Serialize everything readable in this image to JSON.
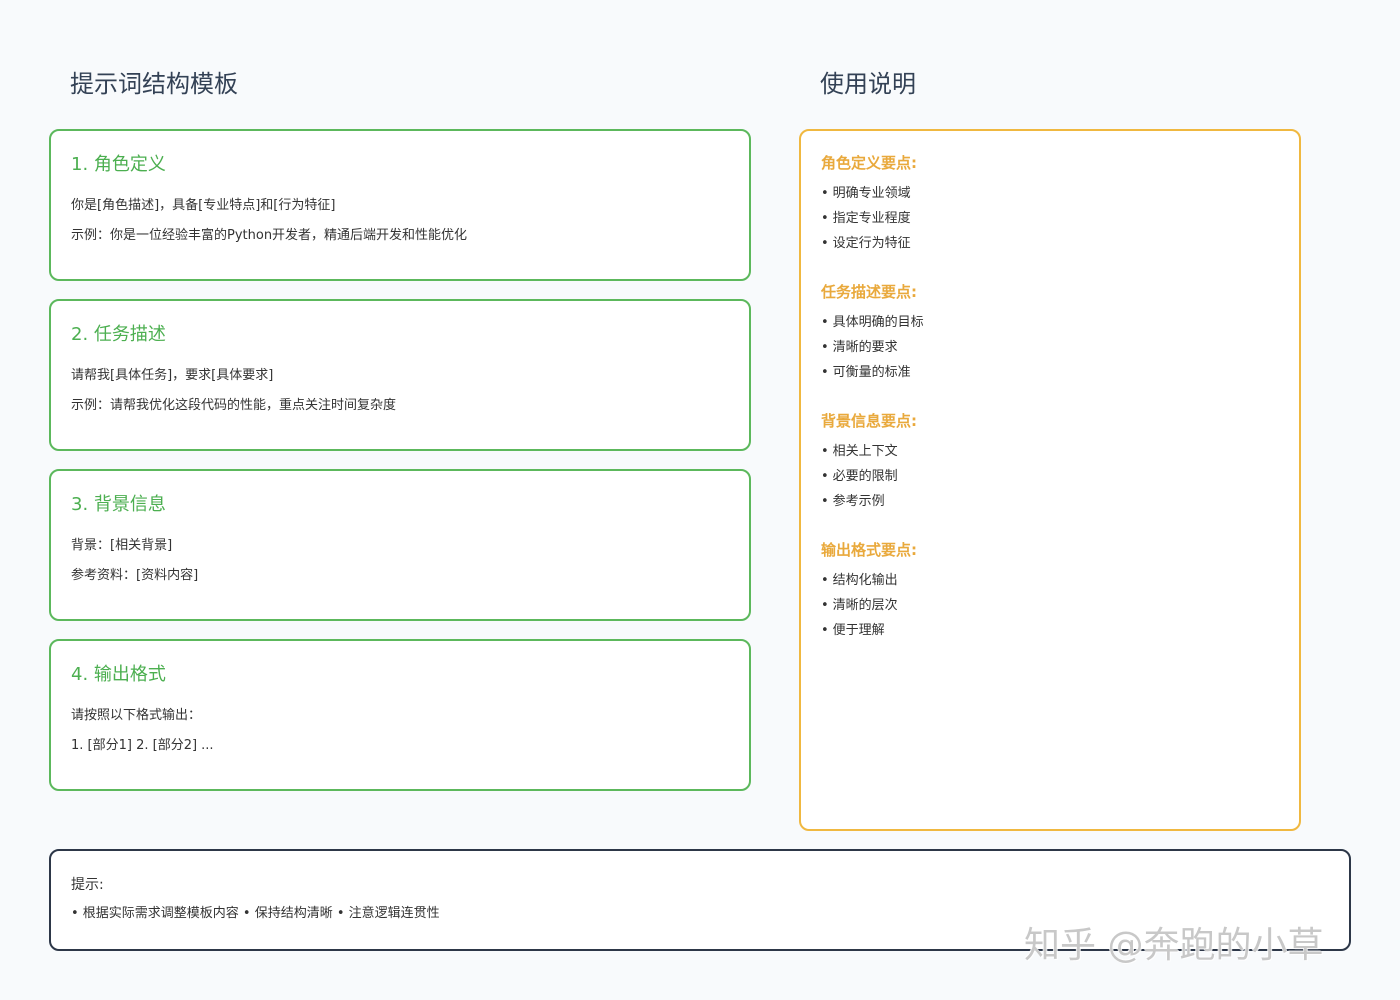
{
  "left_heading": "提示词结构模板",
  "right_heading": "使用说明",
  "template_cards": [
    {
      "title": "1. 角色定义",
      "line1": "你是[角色描述]，具备[专业特点]和[行为特征]",
      "line2": "示例：你是一位经验丰富的Python开发者，精通后端开发和性能优化"
    },
    {
      "title": "2. 任务描述",
      "line1": "请帮我[具体任务]，要求[具体要求]",
      "line2": "示例：请帮我优化这段代码的性能，重点关注时间复杂度"
    },
    {
      "title": "3. 背景信息",
      "line1": "背景：[相关背景]",
      "line2": "参考资料：[资料内容]"
    },
    {
      "title": "4. 输出格式",
      "line1": "请按照以下格式输出：",
      "line2": "1. [部分1] 2. [部分2] ..."
    }
  ],
  "guide_sections": [
    {
      "title": "角色定义要点:",
      "items": [
        "明确专业领域",
        "指定专业程度",
        "设定行为特征"
      ]
    },
    {
      "title": "任务描述要点:",
      "items": [
        "具体明确的目标",
        "清晰的要求",
        "可衡量的标准"
      ]
    },
    {
      "title": "背景信息要点:",
      "items": [
        "相关上下文",
        "必要的限制",
        "参考示例"
      ]
    },
    {
      "title": "输出格式要点:",
      "items": [
        "结构化输出",
        "清晰的层次",
        "便于理解"
      ]
    }
  ],
  "tips": {
    "title": "提示:",
    "body": "• 根据实际需求调整模板内容 • 保持结构清晰 • 注意逻辑连贯性"
  },
  "watermark": "知乎 @奔跑的小草",
  "colors": {
    "template_border": "#5cb85c",
    "template_title": "#4caf50",
    "guide_border": "#f0b840",
    "guide_title": "#e9a93c",
    "tips_border": "#2d3748",
    "background": "#f8fafc"
  }
}
